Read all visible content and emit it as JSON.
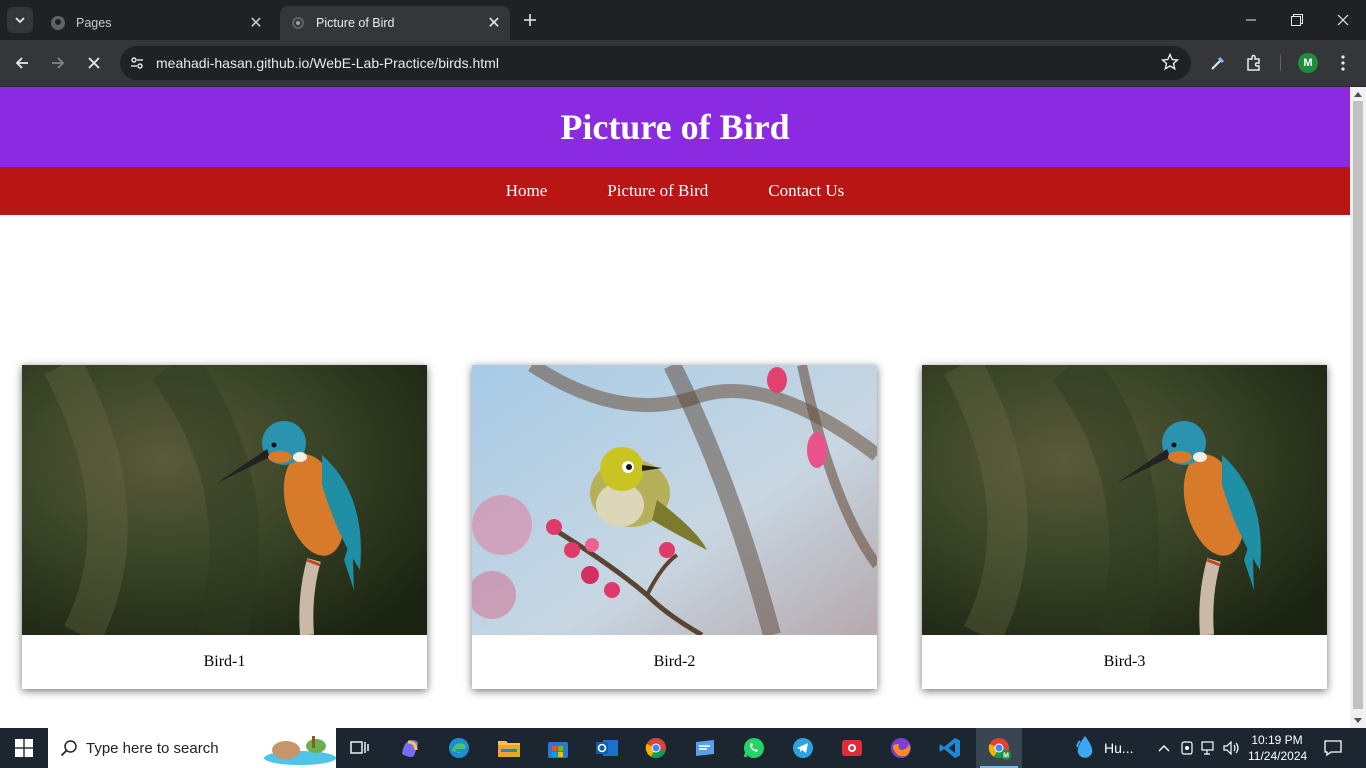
{
  "browser": {
    "tabs": [
      {
        "title": "Pages",
        "active": false
      },
      {
        "title": "Picture of Bird",
        "active": true
      }
    ],
    "url_host": "meahadi-hasan.github.io",
    "url_path": "/WebE-Lab-Practice/birds.html",
    "profile_initial": "M"
  },
  "page": {
    "header_title": "Picture of Bird",
    "nav": [
      "Home",
      "Picture of Bird",
      "Contact Us"
    ],
    "cards": [
      {
        "caption": "Bird-1",
        "image": "kingfisher"
      },
      {
        "caption": "Bird-2",
        "image": "white-eye"
      },
      {
        "caption": "Bird-3",
        "image": "kingfisher"
      }
    ]
  },
  "taskbar": {
    "search_placeholder": "Type here to search",
    "weather_label": "Hu...",
    "time": "10:19 PM",
    "date": "11/24/2024"
  },
  "colors": {
    "header_bg": "#8a2be2",
    "nav_bg": "#b91515"
  }
}
